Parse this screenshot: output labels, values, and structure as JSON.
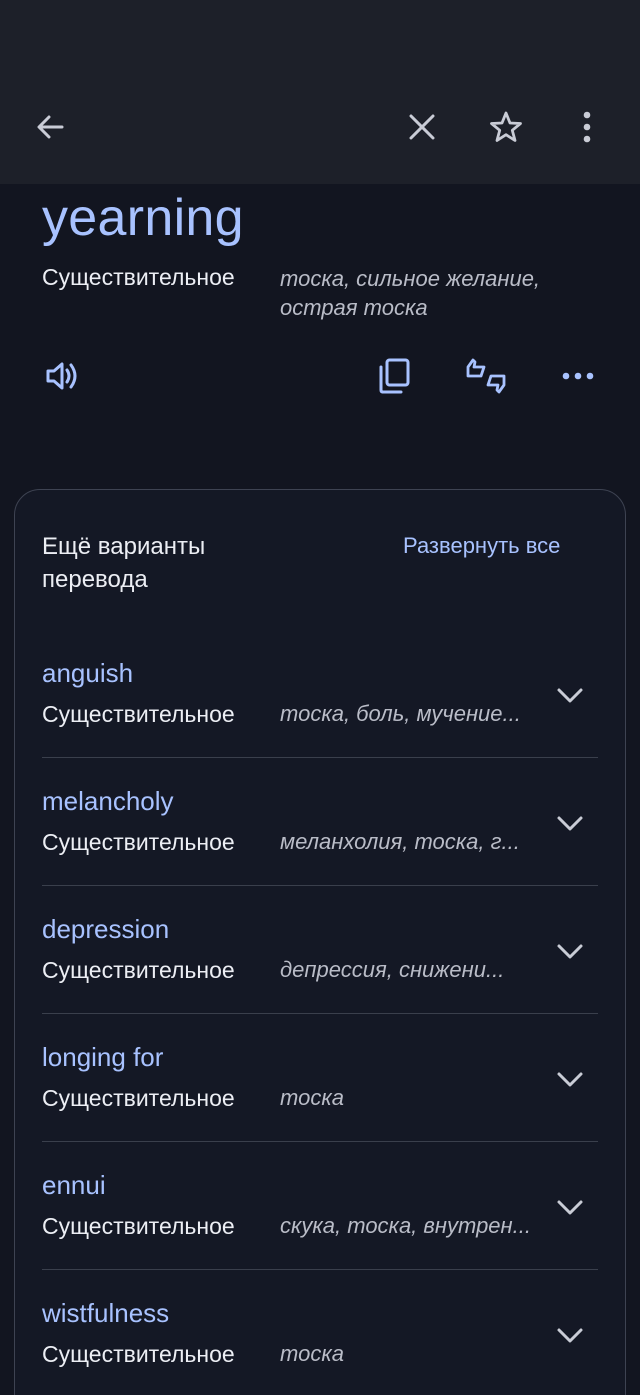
{
  "header": {
    "back_icon": "arrow-left-icon",
    "close_icon": "close-icon",
    "star_icon": "star-outline-icon",
    "menu_icon": "more-vertical-icon"
  },
  "entry": {
    "word": "yearning",
    "part_of_speech": "Существительное",
    "translations": "тоска, сильное желание, острая тоска"
  },
  "actions": {
    "speak_icon": "speaker-icon",
    "copy_icon": "copy-icon",
    "feedback_icon": "thumbs-up-down-icon",
    "more_icon": "more-horizontal-icon"
  },
  "variants": {
    "title": "Ещё варианты перевода",
    "expand_all": "Развернуть все",
    "items": [
      {
        "word": "anguish",
        "pos": "Существительное",
        "translations": "тоска, боль, мучение..."
      },
      {
        "word": "melancholy",
        "pos": "Существительное",
        "translations": "меланхолия, тоска, г..."
      },
      {
        "word": "depression",
        "pos": "Существительное",
        "translations": "депрессия, снижени..."
      },
      {
        "word": "longing for",
        "pos": "Существительное",
        "translations": "тоска"
      },
      {
        "word": "ennui",
        "pos": "Существительное",
        "translations": "скука, тоска, внутрен..."
      },
      {
        "word": "wistfulness",
        "pos": "Существительное",
        "translations": "тоска"
      }
    ]
  },
  "colors": {
    "accent": "#a8c2ff",
    "background": "#121520",
    "topbar": "#1d2029"
  }
}
